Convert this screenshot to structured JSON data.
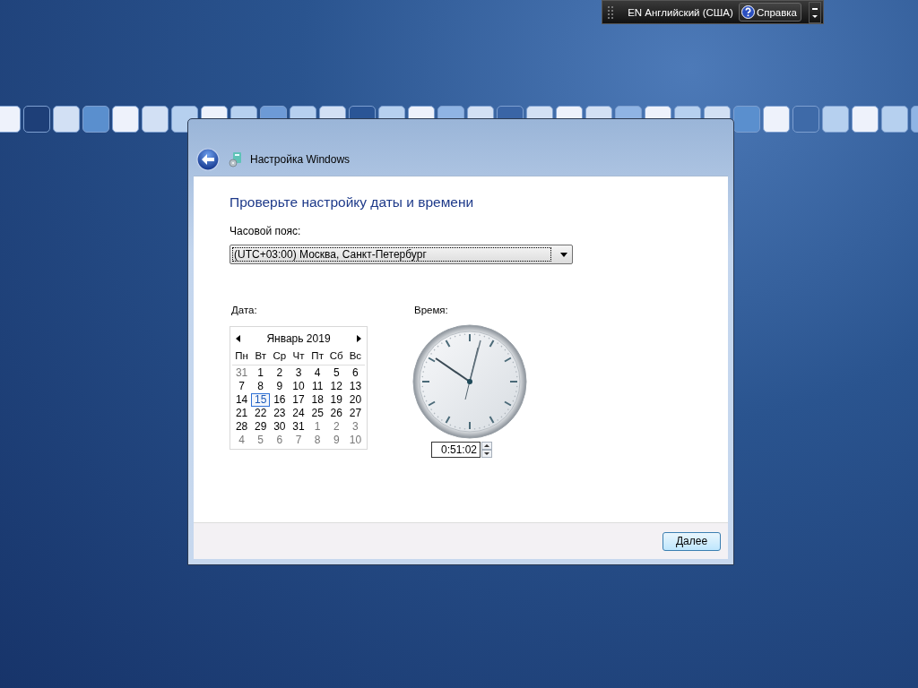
{
  "language_bar": {
    "language": "EN Английский (США)",
    "help": "Справка"
  },
  "window": {
    "title": "Настройка Windows"
  },
  "heading": "Проверьте настройку даты и времени",
  "timezone": {
    "label": "Часовой пояс:",
    "value": "(UTC+03:00) Москва, Санкт-Петербург"
  },
  "date": {
    "label": "Дата:",
    "month": "Январь 2019",
    "weekdays": [
      "Пн",
      "Вт",
      "Ср",
      "Чт",
      "Пт",
      "Сб",
      "Вс"
    ],
    "days": [
      {
        "day": "31",
        "kind": "other",
        "selected": false
      },
      {
        "day": "1",
        "kind": "current",
        "selected": false
      },
      {
        "day": "2",
        "kind": "current",
        "selected": false
      },
      {
        "day": "3",
        "kind": "current",
        "selected": false
      },
      {
        "day": "4",
        "kind": "current",
        "selected": false
      },
      {
        "day": "5",
        "kind": "current",
        "selected": false
      },
      {
        "day": "6",
        "kind": "current",
        "selected": false
      },
      {
        "day": "7",
        "kind": "current",
        "selected": false
      },
      {
        "day": "8",
        "kind": "current",
        "selected": false
      },
      {
        "day": "9",
        "kind": "current",
        "selected": false
      },
      {
        "day": "10",
        "kind": "current",
        "selected": false
      },
      {
        "day": "11",
        "kind": "current",
        "selected": false
      },
      {
        "day": "12",
        "kind": "current",
        "selected": false
      },
      {
        "day": "13",
        "kind": "current",
        "selected": false
      },
      {
        "day": "14",
        "kind": "current",
        "selected": false
      },
      {
        "day": "15",
        "kind": "current",
        "selected": true
      },
      {
        "day": "16",
        "kind": "current",
        "selected": false
      },
      {
        "day": "17",
        "kind": "current",
        "selected": false
      },
      {
        "day": "18",
        "kind": "current",
        "selected": false
      },
      {
        "day": "19",
        "kind": "current",
        "selected": false
      },
      {
        "day": "20",
        "kind": "current",
        "selected": false
      },
      {
        "day": "21",
        "kind": "current",
        "selected": false
      },
      {
        "day": "22",
        "kind": "current",
        "selected": false
      },
      {
        "day": "23",
        "kind": "current",
        "selected": false
      },
      {
        "day": "24",
        "kind": "current",
        "selected": false
      },
      {
        "day": "25",
        "kind": "current",
        "selected": false
      },
      {
        "day": "26",
        "kind": "current",
        "selected": false
      },
      {
        "day": "27",
        "kind": "current",
        "selected": false
      },
      {
        "day": "28",
        "kind": "current",
        "selected": false
      },
      {
        "day": "29",
        "kind": "current",
        "selected": false
      },
      {
        "day": "30",
        "kind": "current",
        "selected": false
      },
      {
        "day": "31",
        "kind": "current",
        "selected": false
      },
      {
        "day": "1",
        "kind": "other",
        "selected": false
      },
      {
        "day": "2",
        "kind": "other",
        "selected": false
      },
      {
        "day": "3",
        "kind": "other",
        "selected": false
      },
      {
        "day": "4",
        "kind": "other",
        "selected": false
      },
      {
        "day": "5",
        "kind": "other",
        "selected": false
      },
      {
        "day": "6",
        "kind": "other",
        "selected": false
      },
      {
        "day": "7",
        "kind": "other",
        "selected": false
      },
      {
        "day": "8",
        "kind": "other",
        "selected": false
      },
      {
        "day": "9",
        "kind": "other",
        "selected": false
      },
      {
        "day": "10",
        "kind": "other",
        "selected": false
      }
    ]
  },
  "time": {
    "label": "Время:",
    "value": "0:51:02"
  },
  "buttons": {
    "next": "Далее"
  }
}
